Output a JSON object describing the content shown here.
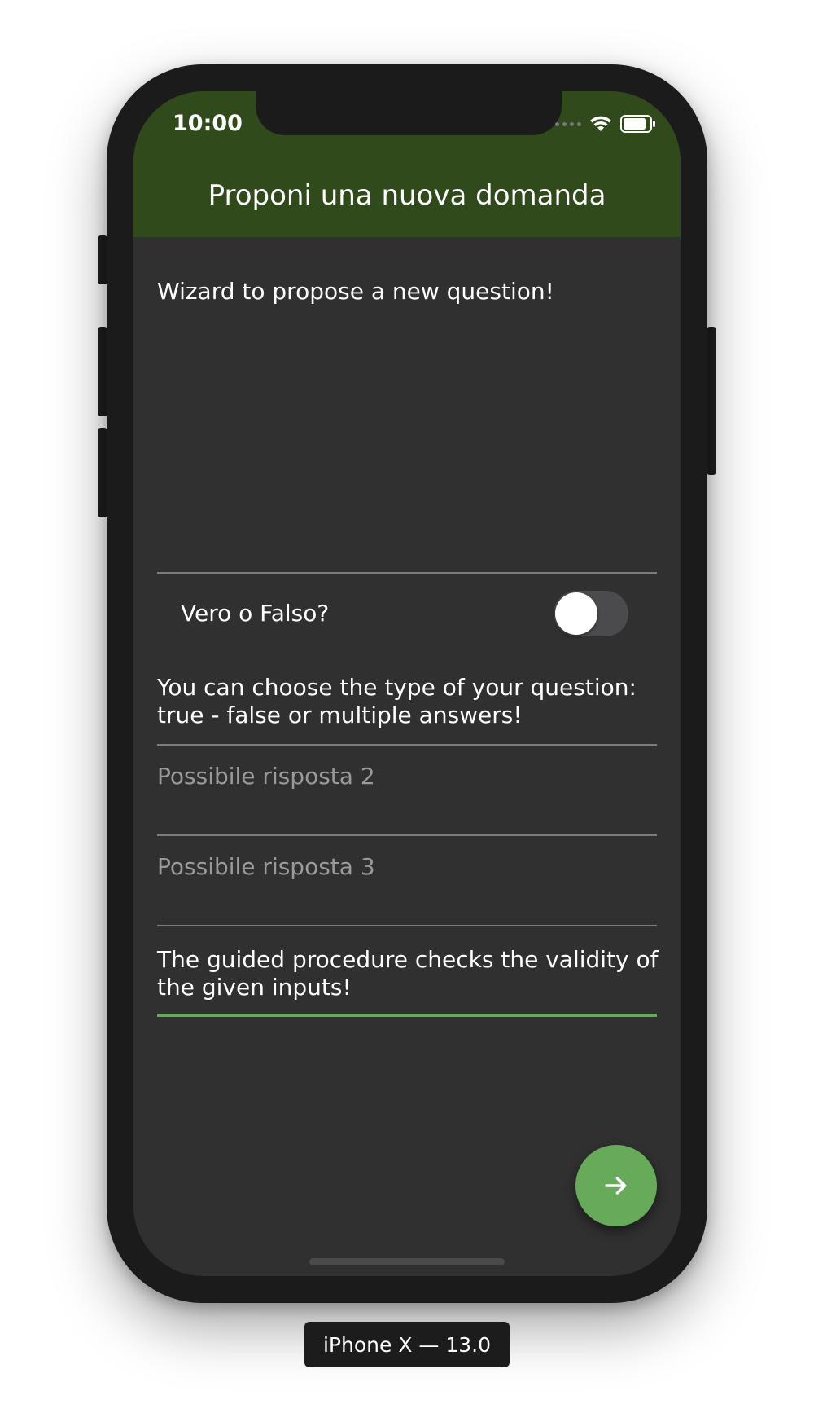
{
  "status_bar": {
    "time": "10:00",
    "icons": [
      "cellular-signal-icon",
      "wifi-icon",
      "battery-icon"
    ]
  },
  "app_bar": {
    "title": "Proponi una nuova domanda",
    "color": "#304a1c"
  },
  "form": {
    "intro_text": "Wizard to propose a new question!",
    "toggle": {
      "label": "Vero o Falso?",
      "checked": false
    },
    "type_hint": "You can choose the type of your question: true - false or multiple answers!",
    "answer_2_placeholder": "Possibile risposta 2",
    "answer_3_placeholder": "Possibile risposta 3",
    "validation_hint": "The guided procedure checks the validity of the given inputs!",
    "accent_color": "#67ab5a"
  },
  "fab": {
    "icon": "arrow-right-icon"
  },
  "device": {
    "label": "iPhone X — 13.0"
  }
}
